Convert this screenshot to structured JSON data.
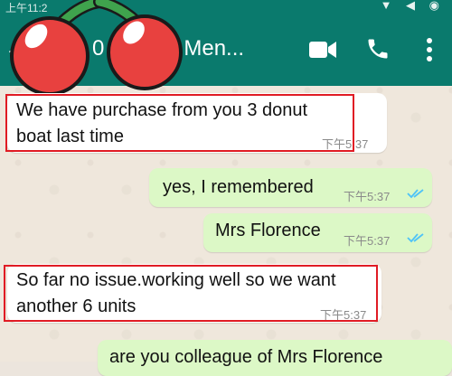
{
  "statusbar": {
    "time": "上午11:2",
    "icons": "▼ ◀ ◉"
  },
  "header": {
    "back_glyph": "←",
    "avatar_text": "0",
    "contact_name": "an Men..."
  },
  "messages": [
    {
      "id": "m1",
      "direction": "incoming",
      "lines": [
        "We have purchase from you 3 donut",
        "boat last time"
      ],
      "time": "下午5:37",
      "highlighted": true
    },
    {
      "id": "m2",
      "direction": "outgoing",
      "lines": [
        "yes, I remembered"
      ],
      "time": "下午5:37",
      "read": true
    },
    {
      "id": "m3",
      "direction": "outgoing",
      "lines": [
        "Mrs Florence"
      ],
      "time": "下午5:37",
      "read": true
    },
    {
      "id": "m4",
      "direction": "incoming",
      "lines": [
        "So far no issue.working well so we want",
        "another 6 units"
      ],
      "time": "下午5:37",
      "highlighted": true
    },
    {
      "id": "m5",
      "direction": "outgoing",
      "lines": [
        "are you colleague of Mrs Florence"
      ]
    }
  ],
  "colors": {
    "header": "#0a7a6d",
    "outgoing": "#dcf8c6",
    "incoming": "#ffffff",
    "highlight_box": "#e01b24",
    "read_ticks": "#4fc3f7"
  },
  "icons": [
    "back-arrow-icon",
    "video-call-icon",
    "phone-icon",
    "more-options-icon",
    "cherry-sticker"
  ]
}
